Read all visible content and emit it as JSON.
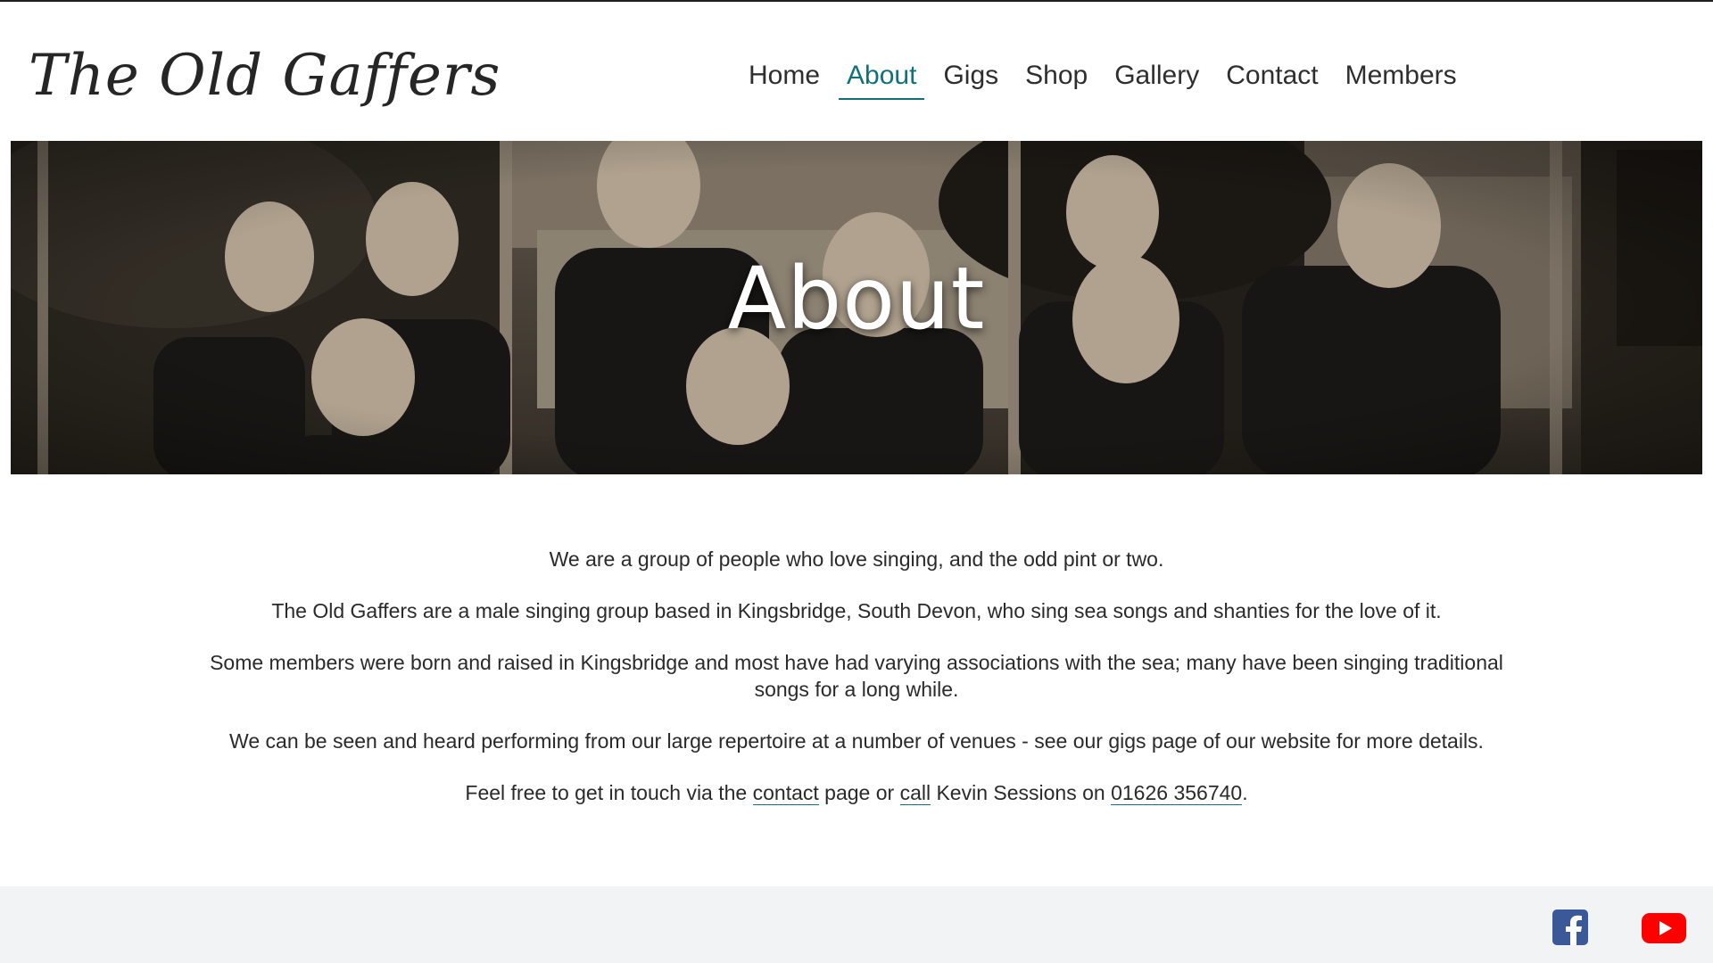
{
  "header": {
    "logo_text": "The Old Gaffers",
    "nav": [
      {
        "label": "Home"
      },
      {
        "label": "About",
        "active": true
      },
      {
        "label": "Gigs"
      },
      {
        "label": "Shop"
      },
      {
        "label": "Gallery"
      },
      {
        "label": "Contact"
      },
      {
        "label": "Members"
      }
    ]
  },
  "hero": {
    "title": "About"
  },
  "content": {
    "p1": "We are a group of people who love singing, and the odd pint or two.",
    "p2": "The Old Gaffers are a male singing group based in Kingsbridge, South Devon, who sing sea songs and shanties for the love of it.",
    "p3": "Some members were born and raised in Kingsbridge and most have had varying associations with the sea; many have been singing traditional songs for a long while.",
    "p4": "We can be seen and heard performing from our large repertoire at a number of venues - see our gigs page of our website for more details.",
    "p5": {
      "before": "Feel free to get in touch via the ",
      "contact_link": "contact",
      "middle": " page or ",
      "call_link": "call",
      "after_call": " Kevin Sessions on ",
      "phone_link": "01626 356740",
      "end": "."
    }
  },
  "footer": {
    "facebook_icon": "facebook-icon",
    "youtube_icon": "youtube-icon",
    "facebook_color": "#3b5998",
    "youtube_color": "#ff0000"
  },
  "colors": {
    "accent": "#12707a",
    "text": "#2a2a2a",
    "footer_bg": "#f2f3f4"
  }
}
